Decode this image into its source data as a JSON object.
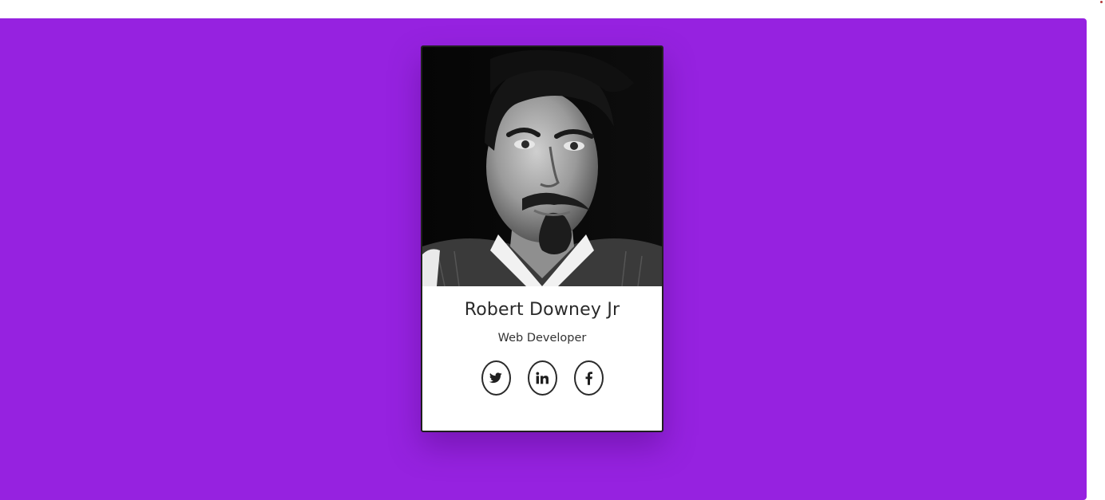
{
  "profile": {
    "name": "Robert Downey Jr",
    "role": "Web Developer",
    "photo_alt": "Robert Downey Jr"
  },
  "socials": [
    {
      "icon": "twitter-icon"
    },
    {
      "icon": "linkedin-icon"
    },
    {
      "icon": "facebook-icon"
    }
  ],
  "colors": {
    "background": "#9622e0",
    "card": "#ffffff",
    "border": "#1f1f1f",
    "text": "#2a2a2a"
  }
}
